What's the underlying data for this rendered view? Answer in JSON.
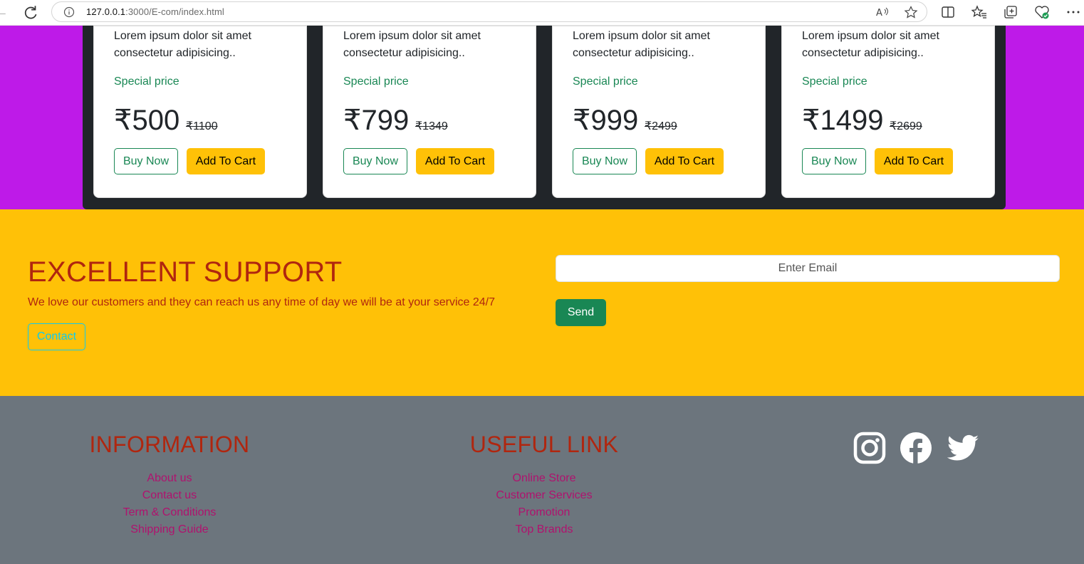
{
  "browser": {
    "url_host": "127.0.0.1",
    "url_rest": ":3000/E-com/index.html"
  },
  "products": [
    {
      "desc": "Lorem ipsum dolor sit amet consectetur adipisicing..",
      "special": "Special price",
      "price": "₹500",
      "old_price": "₹1100",
      "buy_label": "Buy Now",
      "cart_label": "Add To Cart"
    },
    {
      "desc": "Lorem ipsum dolor sit amet consectetur adipisicing..",
      "special": "Special price",
      "price": "₹799",
      "old_price": "₹1349",
      "buy_label": "Buy Now",
      "cart_label": "Add To Cart"
    },
    {
      "desc": "Lorem ipsum dolor sit amet consectetur adipisicing..",
      "special": "Special price",
      "price": "₹999",
      "old_price": "₹2499",
      "buy_label": "Buy Now",
      "cart_label": "Add To Cart"
    },
    {
      "desc": "Lorem ipsum dolor sit amet consectetur adipisicing..",
      "special": "Special price",
      "price": "₹1499",
      "old_price": "₹2699",
      "buy_label": "Buy Now",
      "cart_label": "Add To Cart"
    }
  ],
  "support": {
    "title": "EXCELLENT SUPPORT",
    "text": "We love our customers and they can reach us any time of day we will be at your service 24/7",
    "contact_label": "Contact",
    "email_placeholder": "Enter Email",
    "send_label": "Send"
  },
  "footer": {
    "information": {
      "title": "INFORMATION",
      "links": [
        "About us",
        "Contact us",
        "Term & Conditions",
        "Shipping Guide"
      ]
    },
    "useful": {
      "title": "USEFUL LINK",
      "links": [
        "Online Store",
        "Customer Services",
        "Promotion",
        "Top Brands"
      ]
    },
    "social_icons": [
      "instagram-icon",
      "facebook-icon",
      "twitter-icon"
    ]
  },
  "colors": {
    "purple": "#be1ae8",
    "dark": "#212529",
    "yellow": "#ffc107",
    "green": "#198754",
    "red_text": "#b0260f",
    "footer_bg": "#6c757d",
    "footer_link": "#b0126e"
  }
}
